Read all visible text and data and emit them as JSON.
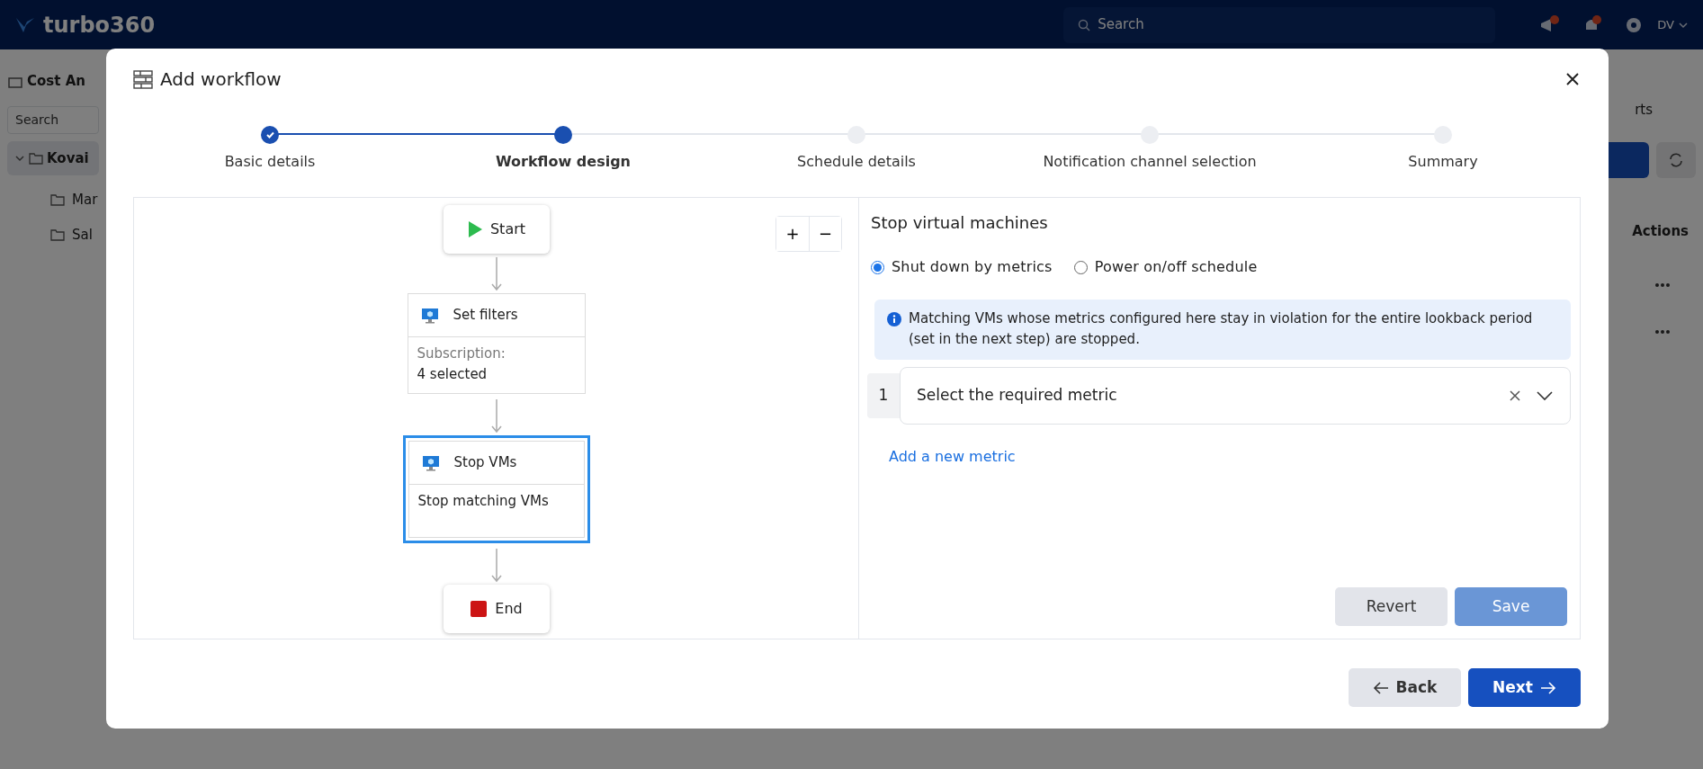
{
  "app_bar": {
    "logo": "turbo360",
    "search_placeholder": "Search",
    "user": "DV"
  },
  "background": {
    "sidebar": {
      "title": "Cost An",
      "search_placeholder": "Search",
      "tree": [
        {
          "label": "Kovai",
          "expanded": true,
          "selected": true,
          "children": [
            {
              "label": "Mar",
              "selected": false
            },
            {
              "label": "Sal",
              "selected": false
            }
          ]
        }
      ]
    },
    "tab_fragment": "rts",
    "table_header": "Actions"
  },
  "modal": {
    "title": "Add workflow",
    "steps": [
      {
        "label": "Basic details",
        "done": true,
        "selected": false
      },
      {
        "label": "Workflow design",
        "done": false,
        "selected": true
      },
      {
        "label": "Schedule details",
        "done": false,
        "selected": false
      },
      {
        "label": "Notification channel selection",
        "done": false,
        "selected": false
      },
      {
        "label": "Summary",
        "done": false,
        "selected": false
      }
    ],
    "canvas": {
      "zoom_controls": [
        "+",
        "−"
      ],
      "nodes": [
        {
          "kind": "start",
          "label": "Start"
        },
        {
          "kind": "step",
          "title": "Set filters",
          "label": "Subscription:",
          "value": "4 selected",
          "selected": false
        },
        {
          "kind": "step",
          "title": "Stop VMs",
          "value": "Stop matching VMs",
          "selected": true
        },
        {
          "kind": "end",
          "label": "End"
        }
      ]
    },
    "panel": {
      "title": "Stop virtual machines",
      "options": [
        {
          "label": "Shut down by metrics",
          "selected": true
        },
        {
          "label": "Power on/off schedule",
          "selected": false
        }
      ],
      "info": "Matching VMs whose metrics configured here stay in violation for the entire lookback period (set in the next step) are stopped.",
      "metrics": [
        {
          "index": "1",
          "placeholder": "Select the required metric"
        }
      ],
      "add_link": "Add a new metric",
      "buttons": [
        {
          "label": "Revert",
          "kind": "secondary",
          "disabled": false
        },
        {
          "label": "Save",
          "kind": "primary",
          "disabled": true
        }
      ]
    },
    "footer": [
      {
        "label": "Back",
        "kind": "back"
      },
      {
        "label": "Next",
        "kind": "next"
      }
    ]
  }
}
